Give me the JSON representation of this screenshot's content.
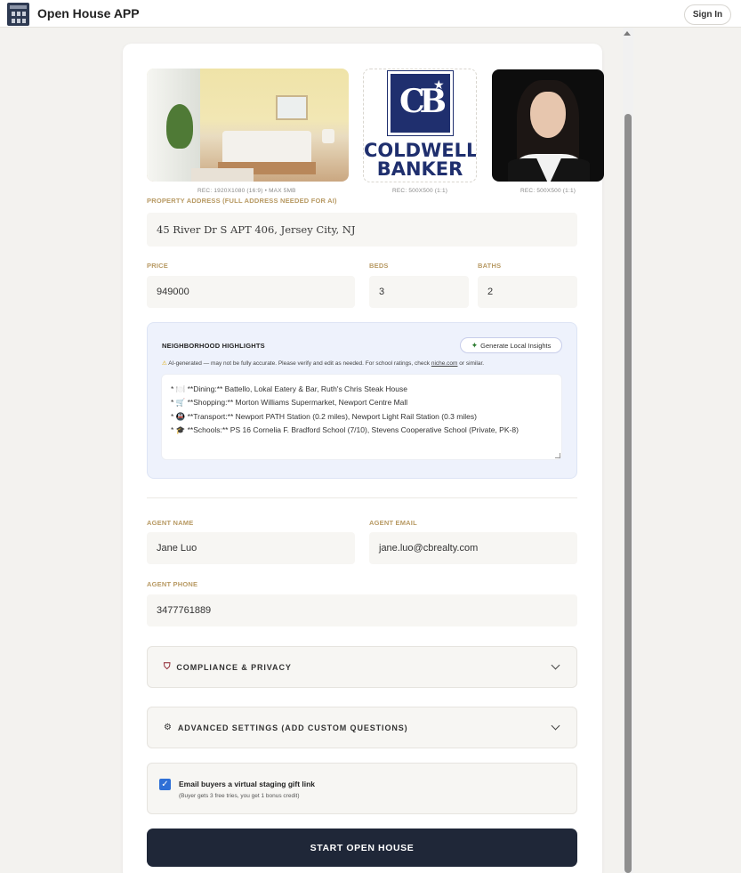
{
  "header": {
    "app_title": "Open House APP",
    "sign_in_label": "Sign In"
  },
  "media": {
    "property_photo_hint": "REC: 1920X1080 (16:9) • MAX 5MB",
    "brand_logo_hint": "REC: 500X500 (1:1)",
    "agent_photo_hint": "REC: 500X500 (1:1)",
    "brand_line1": "COLDWELL",
    "brand_line2": "BANKER",
    "brand_monogram": "CB"
  },
  "property": {
    "address_label": "PROPERTY ADDRESS (FULL ADDRESS NEEDED FOR AI)",
    "address_value": "45 River Dr S APT 406, Jersey City, NJ",
    "price_label": "PRICE",
    "price_value": "949000",
    "beds_label": "BEDS",
    "beds_value": "3",
    "baths_label": "BATHS",
    "baths_value": "2"
  },
  "neighborhood": {
    "title": "NEIGHBORHOOD HIGHLIGHTS",
    "generate_label": "Generate Local Insights",
    "ai_note_prefix": "AI-generated — may not be fully accurate. Please verify and edit as needed. For school ratings, check ",
    "ai_note_link": "niche.com",
    "ai_note_suffix": " or similar.",
    "highlights": [
      "* 🍽️ **Dining:** Battello, Lokal Eatery & Bar, Ruth's Chris Steak House",
      "* 🛒 **Shopping:** Morton Williams Supermarket, Newport Centre Mall",
      "* 🚇 **Transport:** Newport PATH Station (0.2 miles), Newport Light Rail Station (0.3 miles)",
      "* 🎓 **Schools:** PS 16 Cornelia F. Bradford School (7/10), Stevens Cooperative School (Private, PK-8)"
    ]
  },
  "agent": {
    "name_label": "AGENT NAME",
    "name_value": "Jane Luo",
    "email_label": "AGENT EMAIL",
    "email_value": "jane.luo@cbrealty.com",
    "phone_label": "AGENT PHONE",
    "phone_value": "3477761889"
  },
  "sections": {
    "compliance_label": "COMPLIANCE & PRIVACY",
    "advanced_label": "ADVANCED SETTINGS (ADD CUSTOM QUESTIONS)"
  },
  "gift": {
    "title": "Email buyers a virtual staging gift link",
    "subtitle": "(Buyer gets 3 free tries, you get 1 bonus credit)",
    "checked": true
  },
  "start_label": "START OPEN HOUSE",
  "colors": {
    "primary_dark": "#1f2738",
    "label_gold": "#b89a64",
    "brand_blue": "#1f2f6e",
    "checkbox_blue": "#2f6fd6"
  }
}
